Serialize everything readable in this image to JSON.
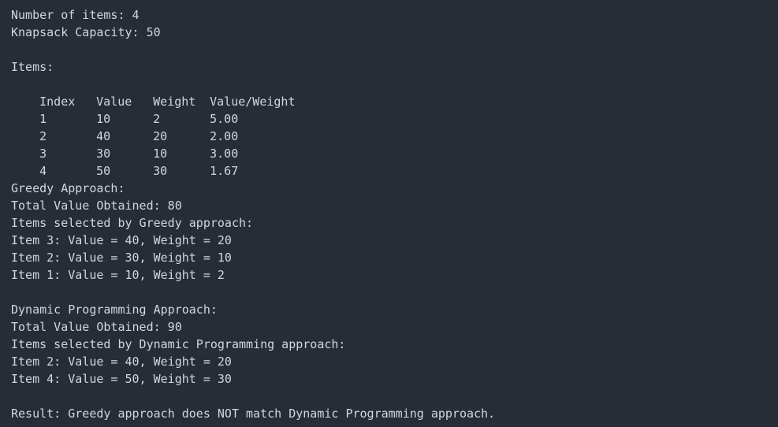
{
  "terminal": {
    "num_items_line": "Number of items: 4",
    "capacity_line": "Knapsack Capacity: 50",
    "items_heading": "Items:",
    "table": {
      "headers": [
        "Index",
        "Value",
        "Weight",
        "Value/Weight"
      ],
      "rows": [
        [
          "1",
          "10",
          "2",
          "5.00"
        ],
        [
          "2",
          "40",
          "20",
          "2.00"
        ],
        [
          "3",
          "30",
          "10",
          "3.00"
        ],
        [
          "4",
          "50",
          "30",
          "1.67"
        ]
      ]
    },
    "greedy": {
      "heading": "Greedy Approach:",
      "total": "Total Value Obtained: 80",
      "selected_heading": "Items selected by Greedy approach:",
      "items": [
        "Item 3: Value = 40, Weight = 20",
        "Item 2: Value = 30, Weight = 10",
        "Item 1: Value = 10, Weight = 2"
      ]
    },
    "dp": {
      "heading": "Dynamic Programming Approach:",
      "total": "Total Value Obtained: 90",
      "selected_heading": "Items selected by Dynamic Programming approach:",
      "items": [
        "Item 2: Value = 40, Weight = 20",
        "Item 4: Value = 50, Weight = 30"
      ]
    },
    "result": "Result: Greedy approach does NOT match Dynamic Programming approach."
  }
}
